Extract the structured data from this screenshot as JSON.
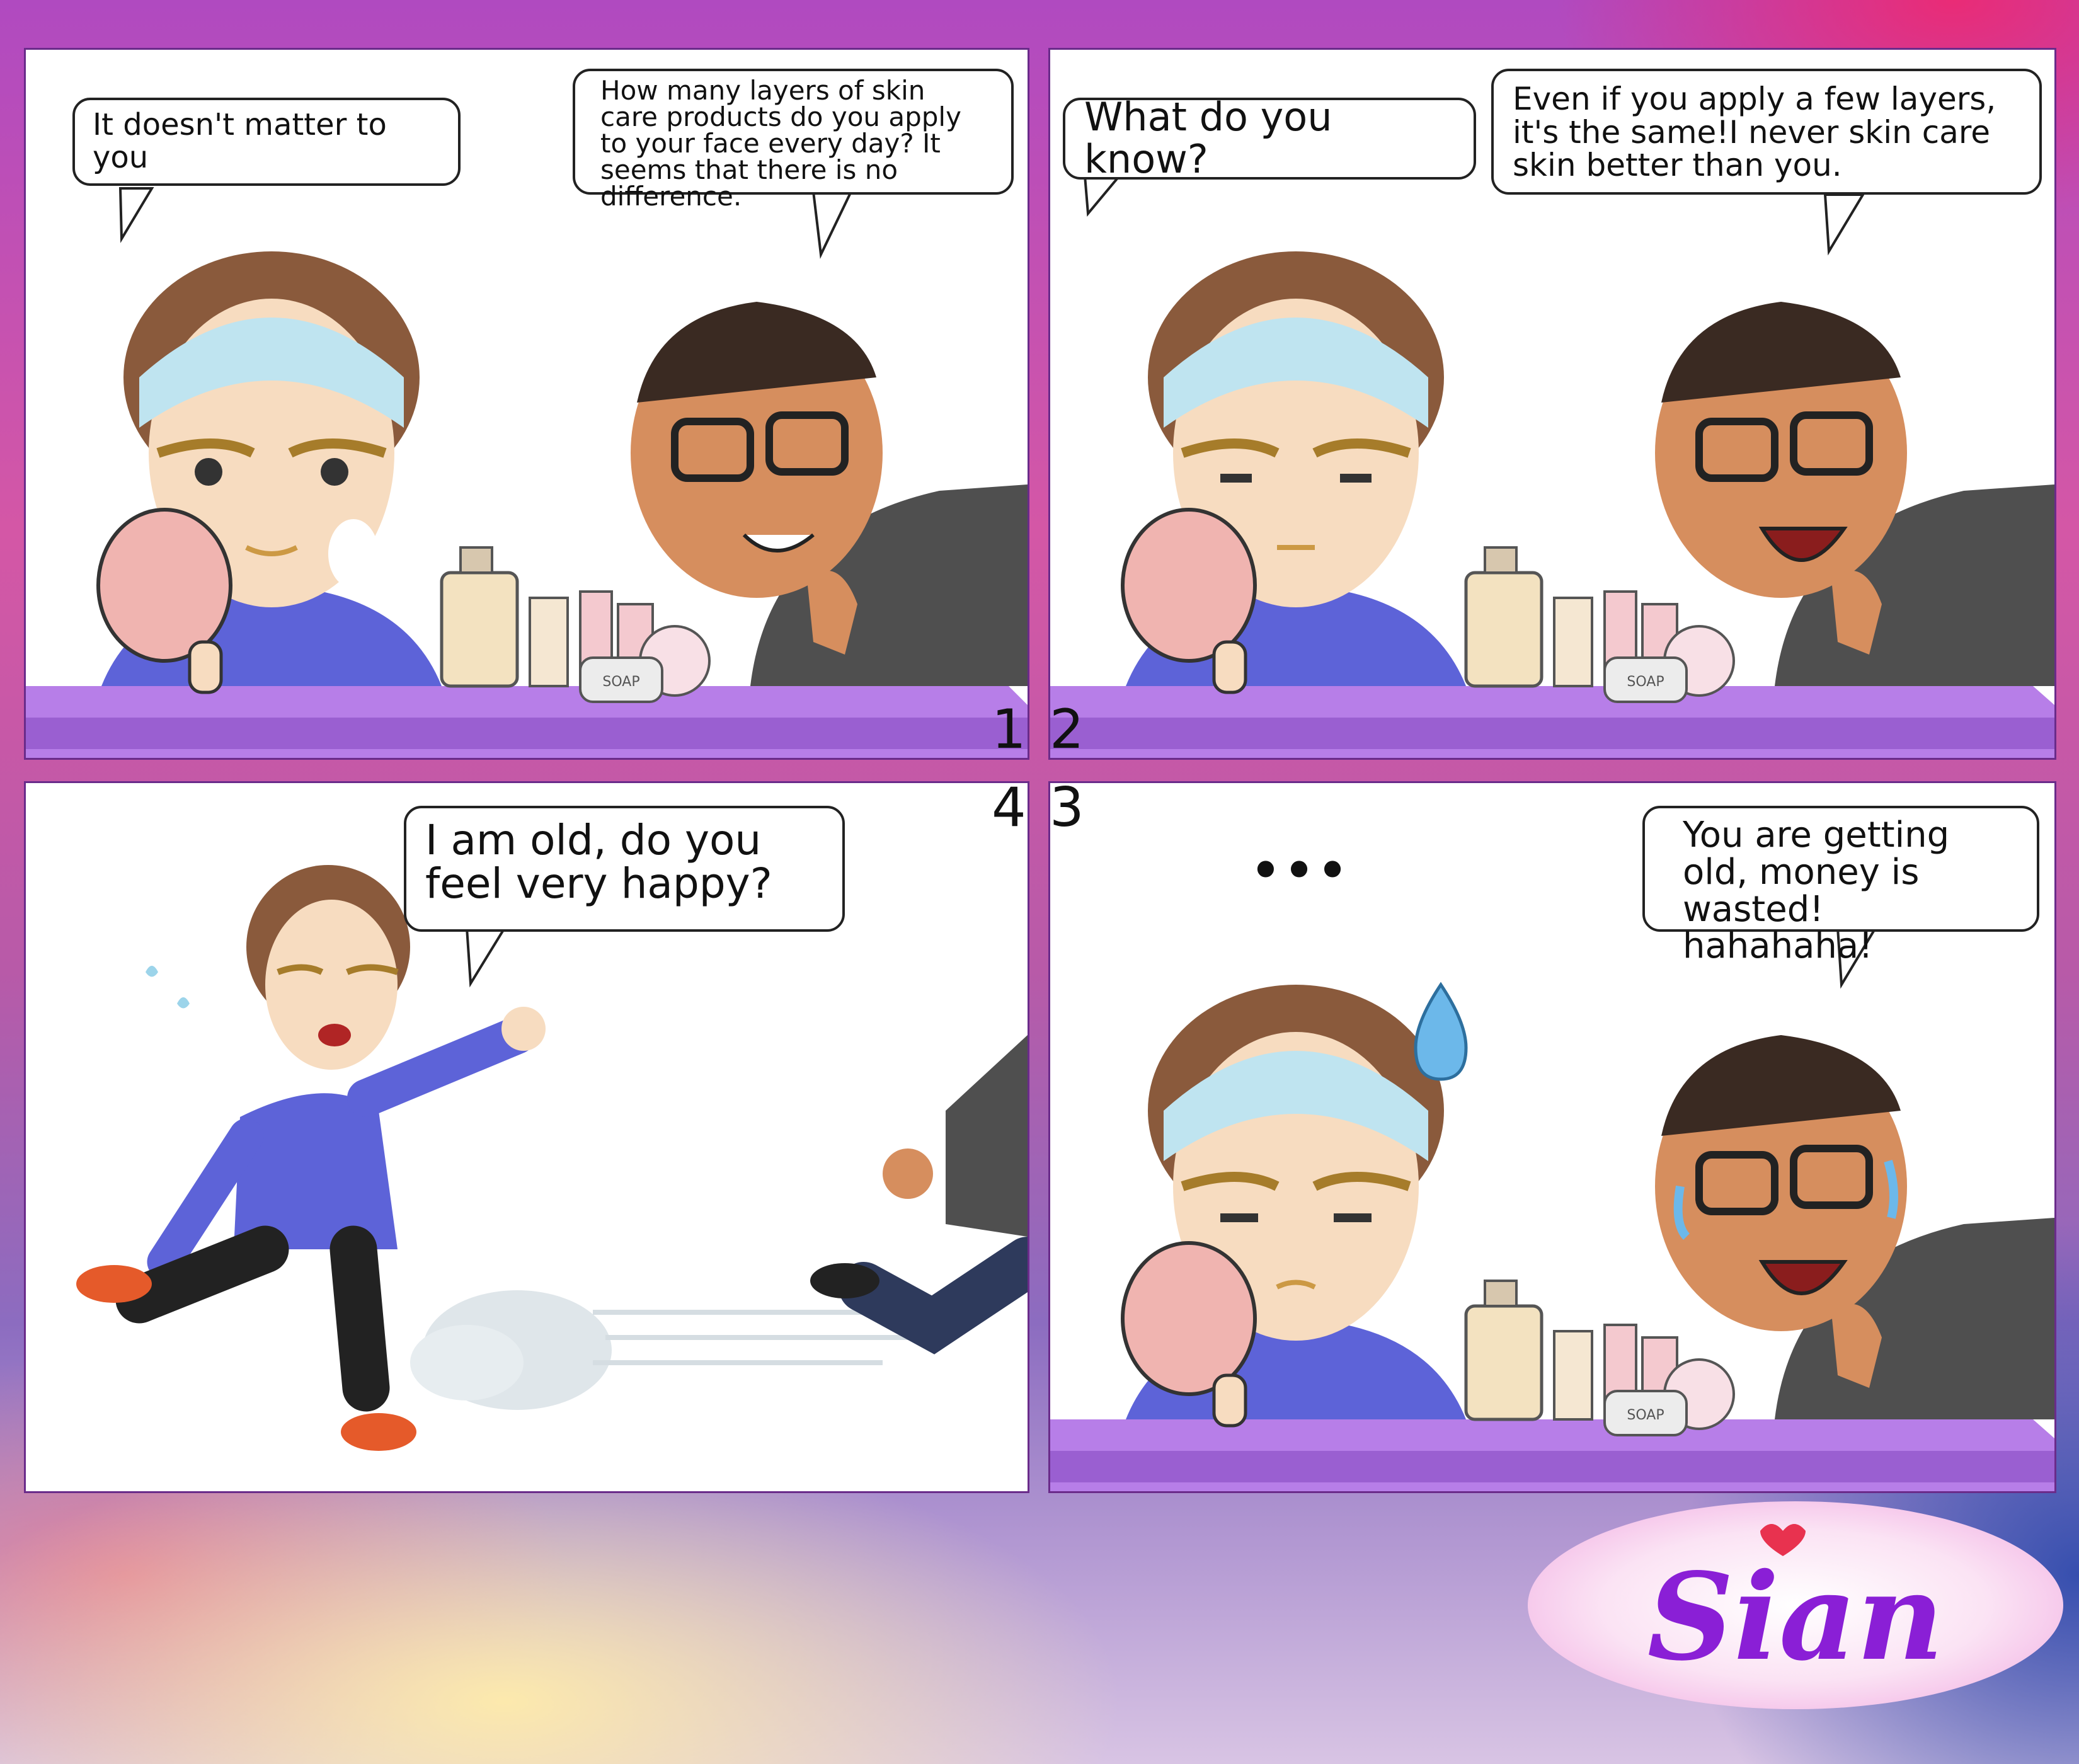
{
  "panels": {
    "p1": {
      "number": "1",
      "bubble_left": "It doesn't matter to you",
      "bubble_right": "How many layers of skin care products do you apply to your face every day? It seems that there is no difference.",
      "product_label": "SOAP"
    },
    "p2": {
      "number": "2",
      "bubble_left": "What do you know?",
      "bubble_right": "Even if you apply a few layers, it's the same!I never skin care skin better than you.",
      "product_label": "SOAP"
    },
    "p4": {
      "number": "4",
      "bubble": "I am old, do you feel very happy?"
    },
    "p3": {
      "number": "3",
      "ellipsis": "•••",
      "bubble": "You are getting old, money is wasted! hahahaha!",
      "product_label": "SOAP"
    }
  },
  "logo": {
    "text": "Sian"
  }
}
